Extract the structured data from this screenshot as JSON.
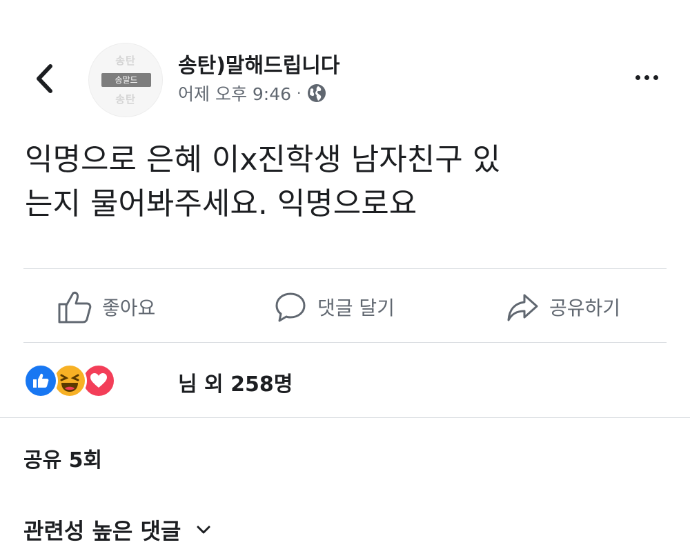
{
  "header": {
    "page_name": "송탄)말해드립니다",
    "timestamp": "어제 오후 9:46",
    "separator": "·",
    "avatar": {
      "watermark_top": "송탄",
      "label": "송말드",
      "watermark_bottom": "송탄"
    },
    "icons": {
      "back": "chevron-left-icon",
      "audience": "globe-icon",
      "more": "more-horizontal-icon"
    }
  },
  "post": {
    "lines": [
      "익명으로 은혜 이x진학생 남자친구 있",
      "는지 물어봐주세요. 익명으로요"
    ]
  },
  "actions": {
    "like": "좋아요",
    "comment": "댓글 달기",
    "share": "공유하기"
  },
  "reactions": {
    "types": [
      "like",
      "haha",
      "love"
    ],
    "colors": {
      "like": "#1877f2",
      "haha": "#f7b125",
      "love": "#f33e58"
    },
    "summary": "님 외 258명"
  },
  "shares": {
    "label": "공유 5회"
  },
  "comments": {
    "sort_label": "관련성 높은 댓글"
  }
}
